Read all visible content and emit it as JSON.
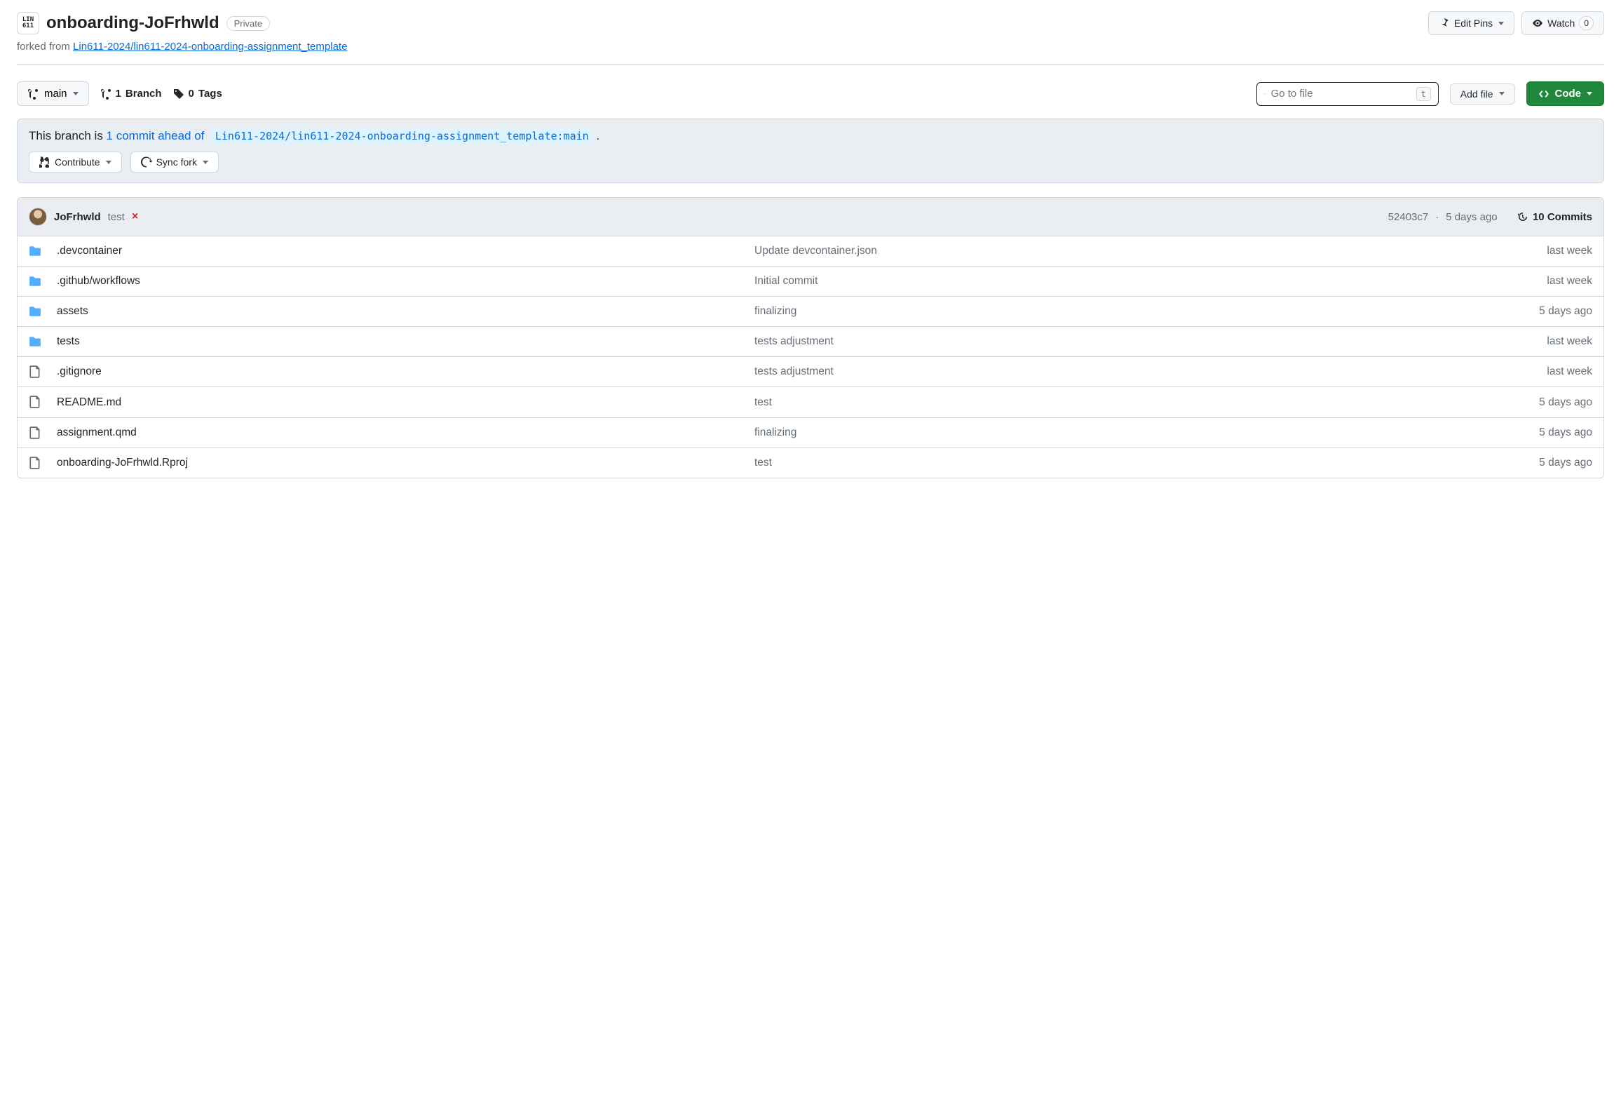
{
  "header": {
    "avatar_line1": "LIN",
    "avatar_line2": "611",
    "repo_name": "onboarding-JoFrhwld",
    "visibility": "Private",
    "edit_pins_label": "Edit Pins",
    "watch_label": "Watch",
    "watch_count": "0"
  },
  "forked": {
    "prefix": "forked from ",
    "link_text": "Lin611-2024/lin611-2024-onboarding-assignment_template"
  },
  "actions": {
    "branch_label": "main",
    "branch_count": "1",
    "branch_word": " Branch",
    "tag_count": "0",
    "tag_word": " Tags",
    "go_to_file_placeholder": "Go to file",
    "key_hint": "t",
    "add_file_label": "Add file",
    "code_label": "Code"
  },
  "fork_status": {
    "prefix": "This branch is ",
    "ahead_link": "1 commit ahead of",
    "compare_ref": "Lin611-2024/lin611-2024-onboarding-assignment_template:main",
    "suffix": " .",
    "contribute_label": "Contribute",
    "sync_label": "Sync fork"
  },
  "commit": {
    "author": "JoFrhwld",
    "message": "test",
    "status_icon": "×",
    "sha": "52403c7",
    "separator": " · ",
    "time": "5 days ago",
    "history_label": "10 Commits"
  },
  "files": [
    {
      "type": "folder",
      "name": ".devcontainer",
      "msg": "Update devcontainer.json",
      "time": "last week"
    },
    {
      "type": "folder",
      "name": ".github/workflows",
      "msg": "Initial commit",
      "time": "last week"
    },
    {
      "type": "folder",
      "name": "assets",
      "msg": "finalizing",
      "time": "5 days ago"
    },
    {
      "type": "folder",
      "name": "tests",
      "msg": "tests adjustment",
      "time": "last week"
    },
    {
      "type": "file",
      "name": ".gitignore",
      "msg": "tests adjustment",
      "time": "last week"
    },
    {
      "type": "file",
      "name": "README.md",
      "msg": "test",
      "time": "5 days ago"
    },
    {
      "type": "file",
      "name": "assignment.qmd",
      "msg": "finalizing",
      "time": "5 days ago"
    },
    {
      "type": "file",
      "name": "onboarding-JoFrhwld.Rproj",
      "msg": "test",
      "time": "5 days ago"
    }
  ]
}
